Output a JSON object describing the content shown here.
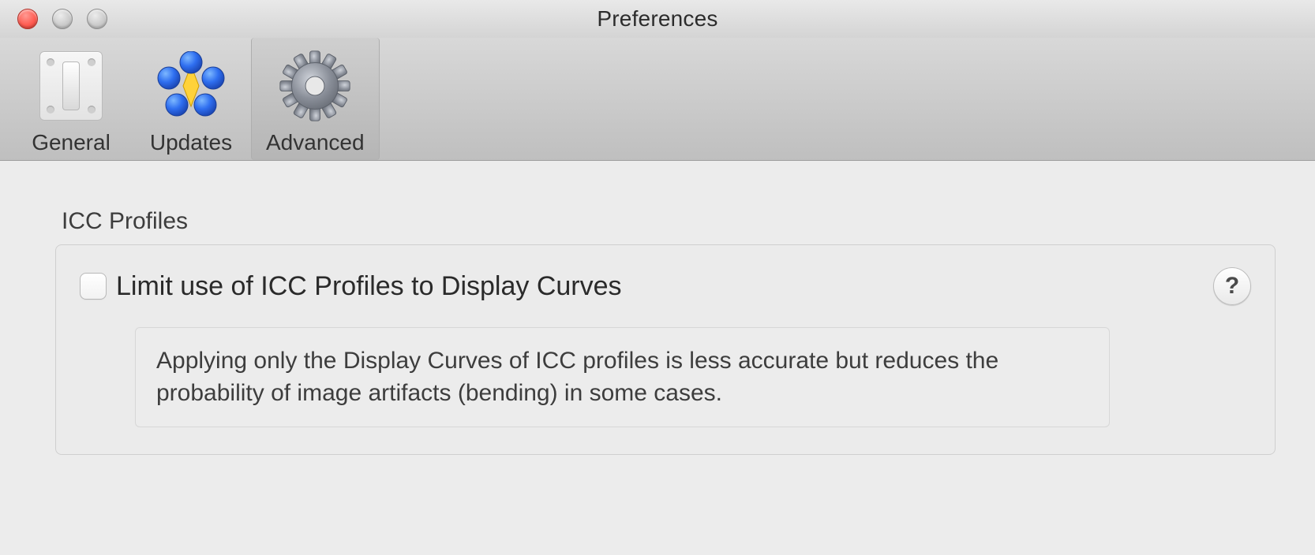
{
  "window": {
    "title": "Preferences"
  },
  "toolbar": {
    "general": {
      "label": "General"
    },
    "updates": {
      "label": "Updates"
    },
    "advanced": {
      "label": "Advanced",
      "selected": true
    }
  },
  "advanced": {
    "section_title": "ICC Profiles",
    "limit_icc": {
      "checked": false,
      "label": "Limit use of ICC Profiles to Display Curves",
      "description": "Applying only the Display Curves of ICC profiles is less accurate but reduces the probability of image artifacts (bending) in some cases."
    },
    "help_glyph": "?"
  }
}
